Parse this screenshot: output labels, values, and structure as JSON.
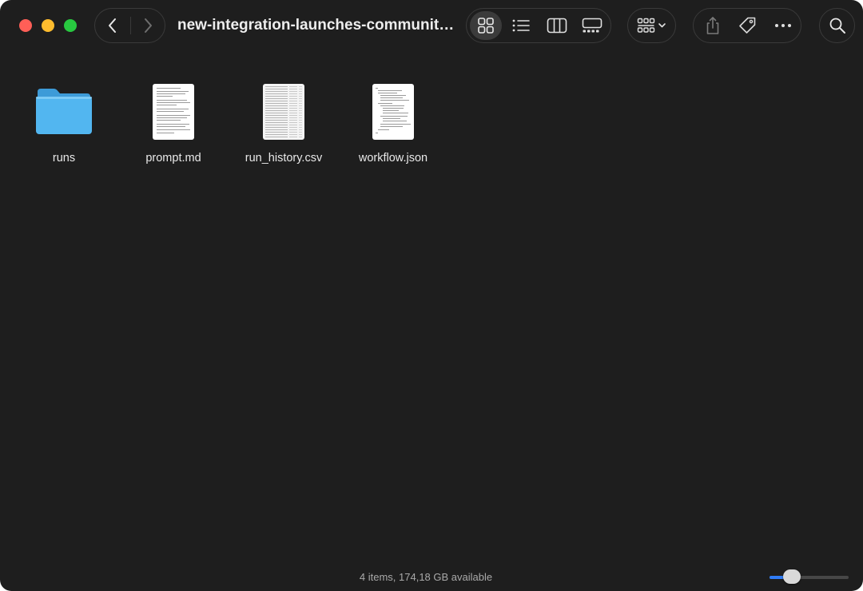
{
  "window": {
    "title": "new-integration-launches-community…"
  },
  "toolbar": {
    "nav": {
      "back_icon": "chevron-left-icon",
      "forward_icon": "chevron-right-icon"
    },
    "view_modes": [
      {
        "name": "icons",
        "icon": "grid-icon",
        "active": true
      },
      {
        "name": "list",
        "icon": "list-icon",
        "active": false
      },
      {
        "name": "columns",
        "icon": "columns-icon",
        "active": false
      },
      {
        "name": "gallery",
        "icon": "gallery-icon",
        "active": false
      }
    ],
    "group_icon": "group-by-icon",
    "actions": [
      "share-icon",
      "tag-icon",
      "more-icon"
    ],
    "search_icon": "search-icon"
  },
  "files": [
    {
      "name": "runs",
      "kind": "folder",
      "icon": "folder-icon"
    },
    {
      "name": "prompt.md",
      "kind": "document",
      "icon": "markdown-file-icon"
    },
    {
      "name": "run_history.csv",
      "kind": "document",
      "icon": "csv-file-icon"
    },
    {
      "name": "workflow.json",
      "kind": "document",
      "icon": "json-file-icon"
    }
  ],
  "status": {
    "summary": "4 items, 174,18 GB available",
    "zoom_level": 0.28
  },
  "colors": {
    "window_bg": "#1e1e1e",
    "accent": "#2f7cf6",
    "folder": "#4fb3ee",
    "traffic_close": "#ff5f57",
    "traffic_minimize": "#febc2e",
    "traffic_zoom": "#28c840"
  }
}
